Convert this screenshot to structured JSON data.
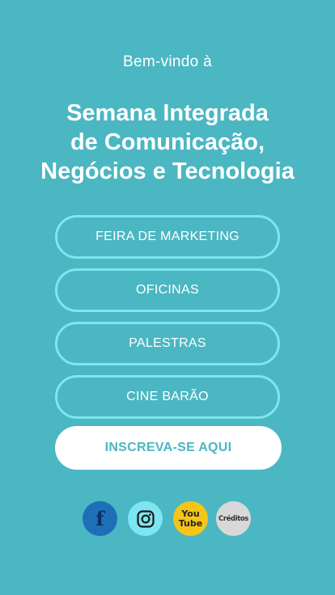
{
  "header": {
    "welcome": "Bem-vindo à",
    "title_lines": [
      "Semana Integrada",
      "de Comunicação,",
      "Negócios e Tecnologia"
    ]
  },
  "menu": {
    "items": [
      {
        "label": "FEIRA DE MARKETING"
      },
      {
        "label": "OFICINAS"
      },
      {
        "label": "PALESTRAS"
      },
      {
        "label": "CINE BARÃO"
      }
    ]
  },
  "cta": {
    "label": "INSCREVA-SE AQUI"
  },
  "social": {
    "facebook": {
      "icon": "facebook-icon",
      "glyph": "f",
      "color": "#1d6fb8"
    },
    "instagram": {
      "icon": "instagram-icon",
      "color": "#7de6f2"
    },
    "youtube": {
      "icon": "youtube-icon",
      "line1": "You",
      "line2": "Tube",
      "color": "#f5c518"
    },
    "credits": {
      "icon": "credits-icon",
      "label": "Créditos",
      "color": "#d8d8d8"
    }
  },
  "colors": {
    "background": "#4bb7c2",
    "button_border": "#7de6ee",
    "cta_text": "#4bb7c2"
  }
}
